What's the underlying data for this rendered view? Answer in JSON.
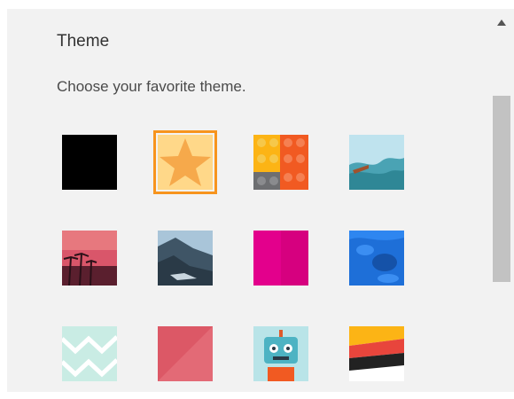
{
  "settings": {
    "title": "Theme",
    "subtitle": "Choose your favorite theme."
  },
  "themes": [
    {
      "icon": "solid-black-swatch-icon",
      "selected": false
    },
    {
      "icon": "orange-star-icon",
      "selected": true
    },
    {
      "icon": "toy-bricks-icon",
      "selected": false
    },
    {
      "icon": "ocean-wave-icon",
      "selected": false
    },
    {
      "icon": "palm-trees-sunset-icon",
      "selected": false
    },
    {
      "icon": "mountain-landscape-icon",
      "selected": false
    },
    {
      "icon": "solid-magenta-swatch-icon",
      "selected": false
    },
    {
      "icon": "blue-water-icon",
      "selected": false
    },
    {
      "icon": "mint-chevron-pattern-icon",
      "selected": false
    },
    {
      "icon": "coral-pink-swatch-icon",
      "selected": false
    },
    {
      "icon": "robot-icon",
      "selected": false
    },
    {
      "icon": "layered-stripes-icon",
      "selected": false
    }
  ],
  "colors": {
    "selected_outline": "#f7941d",
    "panel_background": "#f2f2f2",
    "scroll_thumb": "#c2c2c2"
  }
}
